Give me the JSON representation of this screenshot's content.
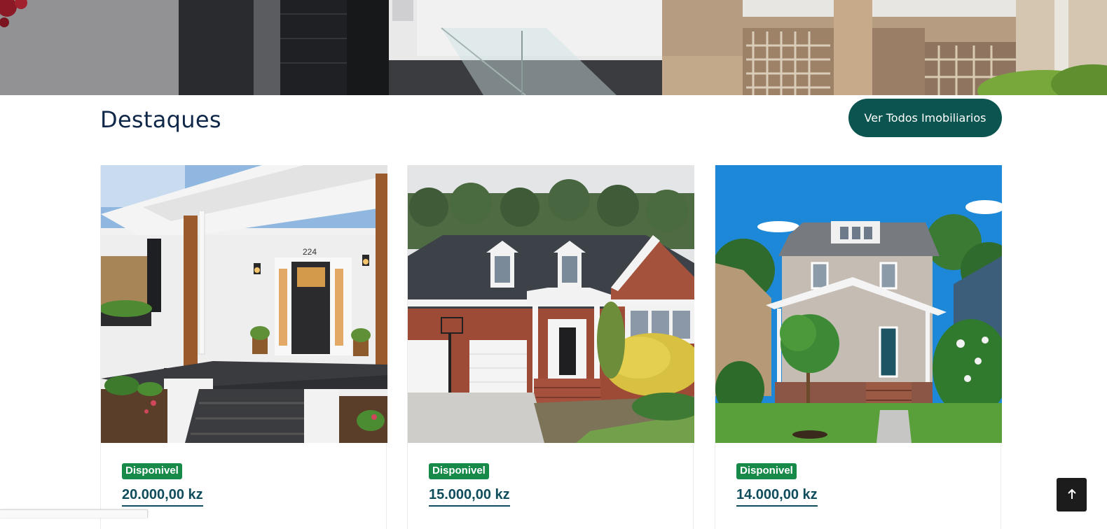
{
  "section": {
    "title": "Destaques",
    "view_all_label": "Ver Todos Imobiliarios"
  },
  "listings": [
    {
      "status": "Disponivel",
      "price": "20.000,00 kz",
      "house_number": "224"
    },
    {
      "status": "Disponivel",
      "price": "15.000,00 kz"
    },
    {
      "status": "Disponivel",
      "price": "14.000,00 kz"
    }
  ],
  "colors": {
    "brand_dark_teal": "#0b5450",
    "title_navy": "#0f2748",
    "badge_green": "#178a4a",
    "price_teal": "#0f4d5c"
  },
  "icons": {
    "back_to_top": "arrow-up-icon"
  }
}
